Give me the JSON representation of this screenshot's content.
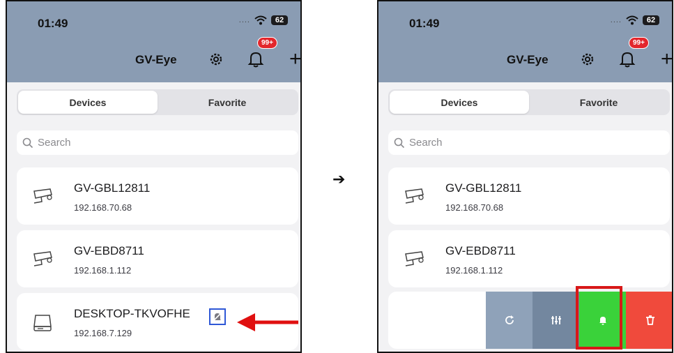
{
  "colors": {
    "header": "#8a9cb3",
    "background": "#f2f2f4",
    "badge": "#e3262c",
    "callout_blue": "#2f58d6",
    "callout_red": "#d81818",
    "action_refresh": "#8fa2b9",
    "action_adjust": "#73879f",
    "action_notify": "#3ad23a",
    "action_delete": "#f04a3c"
  },
  "status_bar": {
    "time": "01:49",
    "signal": "....",
    "battery": "62"
  },
  "header": {
    "title": "GV-Eye",
    "badge": "99+",
    "add_label": "+"
  },
  "tabs": {
    "devices": "Devices",
    "favorite": "Favorite"
  },
  "search": {
    "placeholder": "Search"
  },
  "devices": [
    {
      "name": "GV-GBL12811",
      "ip": "192.168.70.68",
      "icon": "camera-icon"
    },
    {
      "name": "GV-EBD8711",
      "ip": "192.168.1.112",
      "icon": "camera-icon"
    },
    {
      "name": "DESKTOP-TKVOFHE",
      "ip": "192.168.7.129",
      "icon": "hard-drive-icon",
      "status_icon": "bell-muted-icon"
    }
  ],
  "step_arrow": "➔",
  "swipe_actions": [
    "refresh-icon",
    "adjust-icon",
    "bell-icon",
    "trash-icon"
  ]
}
